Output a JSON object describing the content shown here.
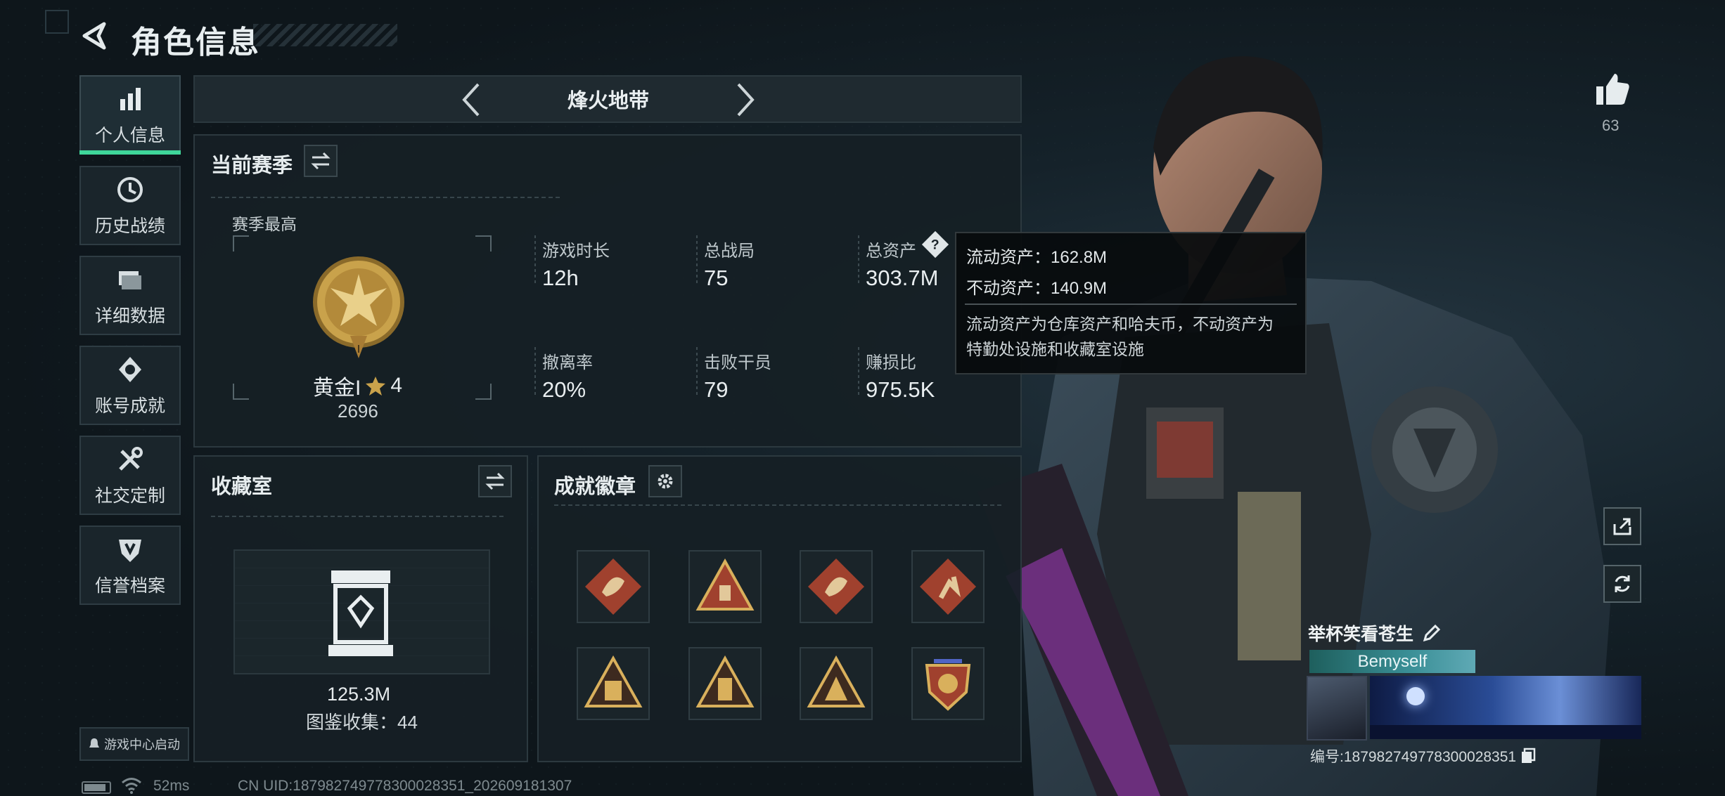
{
  "header": {
    "title": "角色信息"
  },
  "nav": {
    "items": [
      {
        "label": "个人信息",
        "icon": "bar-chart-icon",
        "active": true
      },
      {
        "label": "历史战绩",
        "icon": "history-icon"
      },
      {
        "label": "详细数据",
        "icon": "folder-icon"
      },
      {
        "label": "账号成就",
        "icon": "medal-icon"
      },
      {
        "label": "社交定制",
        "icon": "tools-icon"
      },
      {
        "label": "信誉档案",
        "icon": "shield-icon"
      }
    ],
    "game_center_label": "游戏中心启动"
  },
  "mode": {
    "name": "烽火地带"
  },
  "season": {
    "title": "当前赛季",
    "best_label": "赛季最高",
    "rank_name": "黄金I",
    "rank_stars": "4",
    "rank_score": "2696",
    "stats": [
      {
        "label": "游戏时长",
        "value": "12h"
      },
      {
        "label": "总战局",
        "value": "75"
      },
      {
        "label": "总资产",
        "value": "303.7M"
      },
      {
        "label": "撤离率",
        "value": "20%"
      },
      {
        "label": "击败干员",
        "value": "79"
      },
      {
        "label": "赚损比",
        "value": "975.5K"
      }
    ]
  },
  "tooltip": {
    "liquid": "流动资产：162.8M",
    "fixed": "不动资产：140.9M",
    "note_1": "流动资产为仓库资产和哈夫币，不动资产为",
    "note_2": "特勤处设施和收藏室设施"
  },
  "collection": {
    "title": "收藏室",
    "value": "125.3M",
    "collected": "图鉴收集：44"
  },
  "badges": {
    "title": "成就徽章",
    "items": [
      "dragon-badge",
      "triangle-badge",
      "dragon-badge",
      "runner-badge",
      "tower-badge",
      "tower-badge",
      "tower-badge",
      "shield-badge"
    ]
  },
  "player": {
    "likes": "63",
    "name": "举杯笑看苍生",
    "title_tag": "Bemyself",
    "id": "编号:187982749778300028351"
  },
  "status": {
    "ping": "52ms",
    "uid": "CN UID:187982749778300028351_202609181307"
  },
  "colors": {
    "accent": "#3fd69a",
    "gold": "#c9a24b",
    "badge_red": "#a0412e"
  }
}
